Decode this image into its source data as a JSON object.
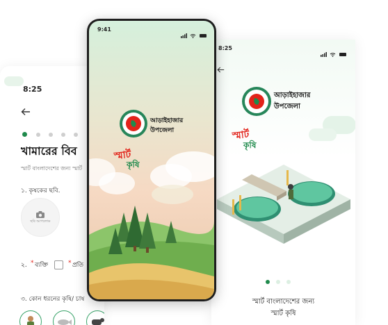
{
  "left_screen": {
    "time": "8:25",
    "title": "খামারের বিব",
    "subtitle": "স্মার্ট বাংলাদেশের জন্য স্মার্ট",
    "q1_label": "১. কৃষকের ছবি.",
    "photo_caption": "ছবি আপলোড",
    "q2_label": "২.",
    "option_individual": "ব্যক্তি",
    "option_org": "প্রতি",
    "asterisk": "*",
    "q3_label": "৩. কোন ধরনের কৃষি/ চাষ"
  },
  "phone": {
    "time": "9:41",
    "brand_name_line1": "আড়াইহাজার",
    "brand_name_line2": "উপজেলা",
    "smart_text": "স্মার্ট",
    "krishi_text": "কৃষি"
  },
  "right_screen": {
    "time": "8:25",
    "brand_name_line1": "আড়াইহাজার",
    "brand_name_line2": "উপজেলা",
    "smart_text": "স্মার্ট",
    "krishi_text": "কৃষি",
    "caption_line1": "স্মার্ট বাংলাদেশের জন্য",
    "caption_line2": "স্মার্ট কৃষি"
  },
  "colors": {
    "brand_green": "#1f8a4c",
    "brand_red": "#e2231a",
    "accent_teal": "#2a8a5c"
  }
}
